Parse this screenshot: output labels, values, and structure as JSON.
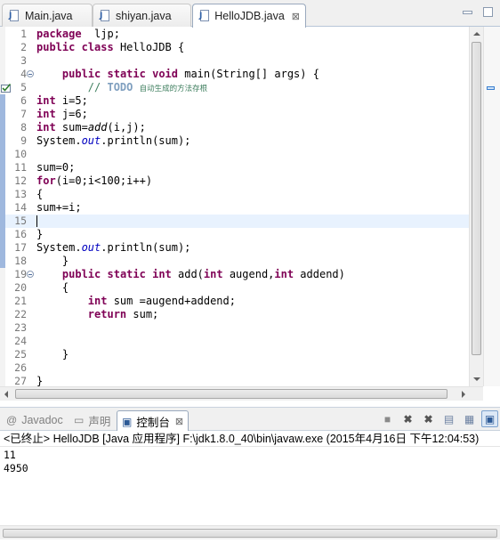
{
  "editor_tabs": [
    {
      "label": "Main.java",
      "active": false,
      "closable": false
    },
    {
      "label": "shiyan.java",
      "active": false,
      "closable": false
    },
    {
      "label": "HelloJDB.java",
      "active": true,
      "closable": true,
      "close_glyph": "⊠"
    }
  ],
  "editor": {
    "lines": [
      {
        "n": "1",
        "parts": [
          [
            "kw",
            "package"
          ],
          [
            "",
            "  ljp;"
          ]
        ]
      },
      {
        "n": "2",
        "parts": [
          [
            "kw",
            "public"
          ],
          [
            "",
            " "
          ],
          [
            "kw",
            "class"
          ],
          [
            "",
            " HelloJDB {"
          ]
        ]
      },
      {
        "n": "3",
        "parts": []
      },
      {
        "n": "4",
        "fold": true,
        "parts": [
          [
            "",
            "    "
          ],
          [
            "kw",
            "public"
          ],
          [
            "",
            " "
          ],
          [
            "kw",
            "static"
          ],
          [
            "",
            " "
          ],
          [
            "kw",
            "void"
          ],
          [
            "",
            " main(String[] args) {"
          ]
        ]
      },
      {
        "n": "5",
        "task": true,
        "parts": [
          [
            "",
            "        "
          ],
          [
            "cm",
            "// "
          ],
          [
            "task",
            "TODO"
          ],
          [
            "",
            " "
          ],
          [
            "cn",
            "自动生成的方法存根"
          ]
        ]
      },
      {
        "n": "6",
        "parts": [
          [
            "kw",
            "int"
          ],
          [
            "",
            " i=5;"
          ]
        ]
      },
      {
        "n": "7",
        "parts": [
          [
            "kw",
            "int"
          ],
          [
            "",
            " j=6;"
          ]
        ]
      },
      {
        "n": "8",
        "parts": [
          [
            "kw",
            "int"
          ],
          [
            "",
            " sum="
          ],
          [
            "it",
            "add"
          ],
          [
            "",
            "(i,j);"
          ]
        ]
      },
      {
        "n": "9",
        "parts": [
          [
            "",
            "System."
          ],
          [
            "st",
            "out"
          ],
          [
            "",
            ".println(sum);"
          ]
        ]
      },
      {
        "n": "10",
        "parts": []
      },
      {
        "n": "11",
        "parts": [
          [
            "",
            "sum=0;"
          ]
        ]
      },
      {
        "n": "12",
        "parts": [
          [
            "kw",
            "for"
          ],
          [
            "",
            "(i=0;i<100;i++)"
          ]
        ]
      },
      {
        "n": "13",
        "parts": [
          [
            "",
            "{"
          ]
        ]
      },
      {
        "n": "14",
        "parts": [
          [
            "",
            "sum+=i;"
          ]
        ]
      },
      {
        "n": "15",
        "current": true,
        "parts": [
          [
            "caret",
            ""
          ]
        ]
      },
      {
        "n": "16",
        "parts": [
          [
            "",
            "}"
          ]
        ]
      },
      {
        "n": "17",
        "parts": [
          [
            "",
            "System."
          ],
          [
            "st",
            "out"
          ],
          [
            "",
            ".println(sum);"
          ]
        ]
      },
      {
        "n": "18",
        "parts": [
          [
            "",
            "    }"
          ]
        ]
      },
      {
        "n": "19",
        "fold": true,
        "parts": [
          [
            "",
            "    "
          ],
          [
            "kw",
            "public"
          ],
          [
            "",
            " "
          ],
          [
            "kw",
            "static"
          ],
          [
            "",
            " "
          ],
          [
            "kw",
            "int"
          ],
          [
            "",
            " add("
          ],
          [
            "kw",
            "int"
          ],
          [
            "",
            " augend,"
          ],
          [
            "kw",
            "int"
          ],
          [
            "",
            " addend)"
          ]
        ]
      },
      {
        "n": "20",
        "parts": [
          [
            "",
            "    {"
          ]
        ]
      },
      {
        "n": "21",
        "parts": [
          [
            "",
            "        "
          ],
          [
            "kw",
            "int"
          ],
          [
            "",
            " sum =augend+addend;"
          ]
        ]
      },
      {
        "n": "22",
        "parts": [
          [
            "",
            "        "
          ],
          [
            "kw",
            "return"
          ],
          [
            "",
            " sum;"
          ]
        ]
      },
      {
        "n": "23",
        "parts": []
      },
      {
        "n": "24",
        "parts": []
      },
      {
        "n": "25",
        "parts": [
          [
            "",
            "    }"
          ]
        ]
      },
      {
        "n": "26",
        "parts": []
      },
      {
        "n": "27",
        "parts": [
          [
            "",
            "}"
          ]
        ]
      }
    ],
    "marked_lines_left_ruler": [
      "6",
      "7",
      "8",
      "9",
      "10",
      "11",
      "12",
      "13",
      "14",
      "15",
      "16",
      "17",
      "18"
    ]
  },
  "view_tabs": [
    {
      "label": "Javadoc",
      "icon": "@",
      "active": false
    },
    {
      "label": "声明",
      "icon": "📄",
      "active": false
    },
    {
      "label": "控制台",
      "icon": "▣",
      "active": true,
      "close_glyph": "⊠"
    }
  ],
  "toolbar_icons": [
    {
      "name": "terminate-icon",
      "glyph": "■"
    },
    {
      "name": "remove-launch-icon",
      "glyph": "✖"
    },
    {
      "name": "remove-all-terminated-icon",
      "glyph": "✖"
    },
    {
      "name": "scroll-lock-icon",
      "glyph": "▤"
    },
    {
      "name": "word-wrap-icon",
      "glyph": "▦"
    },
    {
      "name": "show-console-icon",
      "glyph": "▣"
    }
  ],
  "console": {
    "header": "<已终止> HelloJDB [Java 应用程序] F:\\jdk1.8.0_40\\bin\\javaw.exe (2015年4月16日 下午12:04:53)",
    "output": [
      "11",
      "4950"
    ]
  }
}
